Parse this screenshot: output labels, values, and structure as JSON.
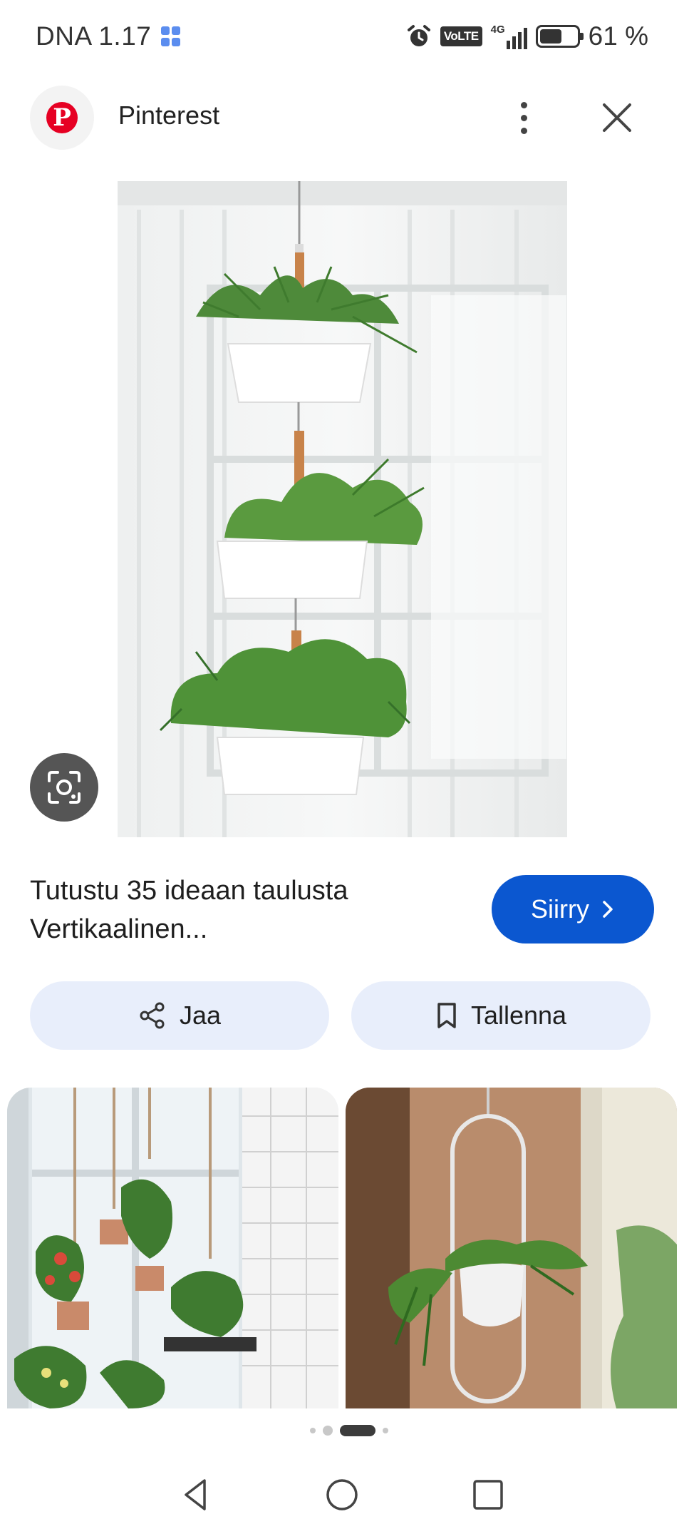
{
  "status_bar": {
    "carrier_time": "DNA 1.17",
    "volte": "VoLTE",
    "network": "4G",
    "battery_text": "61 %",
    "battery_level_percent": 61,
    "icons": [
      "app-grid-icon",
      "alarm-icon",
      "volte-icon",
      "signal-icon",
      "battery-icon"
    ]
  },
  "header": {
    "site_name": "Pinterest",
    "logo_letter": "P",
    "logo_color": "#e60023",
    "more_icon": "more-vert-icon",
    "close_icon": "close-icon"
  },
  "result": {
    "title": "Tutustu 35 ideaan taulusta Vertikaalinen...",
    "visit_label": "Siirry",
    "visit_icon": "chevron-right-icon",
    "accent_color": "#0b57d0"
  },
  "actions": {
    "share_label": "Jaa",
    "share_icon": "share-icon",
    "save_label": "Tallenna",
    "save_icon": "bookmark-icon"
  },
  "page_indicator": {
    "count": 4,
    "active_index": 2
  },
  "nav": {
    "icons": [
      "back-icon",
      "home-icon",
      "recents-icon"
    ]
  }
}
